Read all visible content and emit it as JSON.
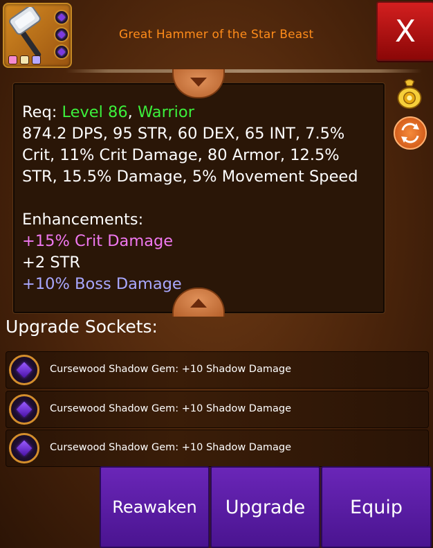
{
  "item": {
    "title": "Great Hammer of the Star Beast",
    "icon": "great-hammer-icon",
    "rarity_dot_colors": [
      "#f58ad0",
      "#f4e6b0",
      "#b6a8ff"
    ]
  },
  "close_button": {
    "label": "X"
  },
  "description": {
    "req_label": "Req: ",
    "req_level": "Level 86",
    "req_sep": ", ",
    "req_class": "Warrior",
    "stats_lines": [
      "874.2 DPS, 95 STR, 60 DEX, 65 INT, 7.5%",
      "Crit, 11% Crit Damage, 80 Armor, 12.5%",
      "STR, 15.5% Damage, 5% Movement Speed"
    ],
    "enhancements_label": "Enhancements:",
    "enhancements": [
      {
        "text": "+15% Crit Damage",
        "color": "#f078f0"
      },
      {
        "text": "+2 STR",
        "color": "#ffffff"
      },
      {
        "text": "+10% Boss Damage",
        "color": "#a9a8ff"
      }
    ]
  },
  "side_icons": [
    "money-bag-icon",
    "swap-icon"
  ],
  "sockets": {
    "title": "Upgrade Sockets:",
    "items": [
      {
        "icon": "shadow-gem-icon",
        "text": "Cursewood Shadow Gem: +10 Shadow Damage"
      },
      {
        "icon": "shadow-gem-icon",
        "text": "Cursewood Shadow Gem: +10 Shadow Damage"
      },
      {
        "icon": "shadow-gem-icon",
        "text": "Cursewood Shadow Gem: +10 Shadow Damage"
      }
    ]
  },
  "buttons": {
    "reawaken": "Reawaken",
    "upgrade": "Upgrade",
    "equip": "Equip"
  },
  "colors": {
    "title_orange": "#ff8c1a",
    "req_green": "#3cf03c",
    "close_red": "#c81a1a",
    "button_purple": "#5a1ca4"
  }
}
